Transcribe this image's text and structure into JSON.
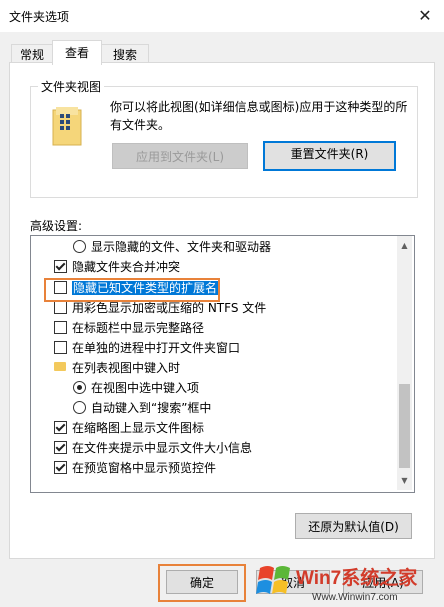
{
  "window": {
    "title": "文件夹选项",
    "close_glyph": "✕"
  },
  "tabs": [
    {
      "label": "常规",
      "active": false
    },
    {
      "label": "查看",
      "active": true
    },
    {
      "label": "搜索",
      "active": false
    }
  ],
  "folder_views": {
    "legend": "文件夹视图",
    "description_line1": "你可以将此视图(如详细信息或图标)应用于这种类型的所",
    "description_line2": "有文件夹。",
    "apply_button": "应用到文件夹(L)",
    "reset_button": "重置文件夹(R)"
  },
  "advanced": {
    "label": "高级设置:",
    "items": [
      {
        "kind": "radio",
        "checked": false,
        "text": "显示隐藏的文件、文件夹和驱动器",
        "indent": 1
      },
      {
        "kind": "checkbox",
        "checked": true,
        "text": "隐藏文件夹合并冲突",
        "indent": 0
      },
      {
        "kind": "checkbox",
        "checked": false,
        "text": "隐藏已知文件类型的扩展名",
        "indent": 0,
        "selected": true
      },
      {
        "kind": "checkbox",
        "checked": false,
        "text": "用彩色显示加密或压缩的 NTFS 文件",
        "indent": 0
      },
      {
        "kind": "checkbox",
        "checked": false,
        "text": "在标题栏中显示完整路径",
        "indent": 0
      },
      {
        "kind": "checkbox",
        "checked": false,
        "text": "在单独的进程中打开文件夹窗口",
        "indent": 0
      },
      {
        "kind": "folder",
        "checked": false,
        "text": "在列表视图中键入时",
        "indent": 0
      },
      {
        "kind": "radio",
        "checked": true,
        "text": "在视图中选中键入项",
        "indent": 1
      },
      {
        "kind": "radio",
        "checked": false,
        "text": "自动键入到“搜索”框中",
        "indent": 1
      },
      {
        "kind": "checkbox",
        "checked": true,
        "text": "在缩略图上显示文件图标",
        "indent": 0
      },
      {
        "kind": "checkbox",
        "checked": true,
        "text": "在文件夹提示中显示文件大小信息",
        "indent": 0
      },
      {
        "kind": "checkbox",
        "checked": true,
        "text": "在预览窗格中显示预览控件",
        "indent": 0
      }
    ],
    "restore_button": "还原为默认值(D)"
  },
  "footer": {
    "ok_button": "确定",
    "cancel_button": "取消",
    "apply_button": "应用(A)"
  },
  "watermark": {
    "brand_text": "Win7系统之家",
    "url_text": "Www.Winwin7.com"
  },
  "colors": {
    "accent": "#0078d7",
    "annotation": "#e8823a",
    "panel": "#ffffff",
    "window": "#f0f0f0"
  }
}
